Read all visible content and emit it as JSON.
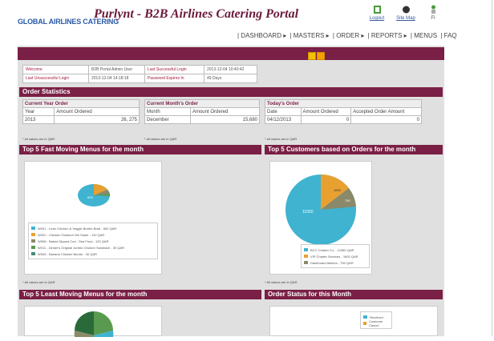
{
  "header": {
    "logo_text": "GLOBAL AIRLINES CATERING",
    "title": "Purlynt - B2B Airlines Catering Portal",
    "icons": [
      {
        "name": "logout-icon",
        "label": "Logout"
      },
      {
        "name": "site-map-icon",
        "label": "Site Map"
      },
      {
        "name": "faq-icon",
        "label": "FI"
      }
    ],
    "nav": [
      "| DASHBOARD ▸",
      "| MASTERS ▸",
      "| ORDER ▸",
      "| REPORTS ▸",
      "| MENUS",
      "| FAQ"
    ]
  },
  "info": {
    "welcome_label": "Welcome",
    "welcome_value": "B2B Portal Admin User",
    "last_success_label": "Last Successful Login",
    "last_success_value": "2013-12-04 10:40:42",
    "last_fail_label": "Last Unsuccessful Login",
    "last_fail_value": "2013-12-04 14:18:18",
    "pwd_expiry_label": "Password Expires In",
    "pwd_expiry_value": "49 Days"
  },
  "order_stats": {
    "title": "Order Statistics",
    "year": {
      "title": "Current Year Order",
      "h1": "Year",
      "h2": "Amount Ordered",
      "c1": "2013",
      "c2": "26, 275"
    },
    "month": {
      "title": "Current Month's Order",
      "h1": "Month",
      "h2": "Amount Ordered",
      "c1": "December",
      "c2": "15,680"
    },
    "today": {
      "title": "Today's Order",
      "h1": "Date",
      "h2": "Amount Ordered",
      "h3": "Accepted Order Amount",
      "c1": "04/12/2013",
      "c2": "0",
      "c3": "0"
    },
    "note": "* all values are in QAR"
  },
  "fast_menus": {
    "title": "Top 5 Fast Moving Menus for the month",
    "note": "* All values are in QAR",
    "legend": [
      "W001 - Lean Chicken & Veggie Burrito Bowl - 600 QAR",
      "W002 - Chicken Tandoori Stir Saute - 110 QAR",
      "W008 - Baked Dipped Cod - Sea Food - 120 QAR",
      "W011 - Dinner's Original Jumbo Chicken Sandwich - 30 QAR",
      "W005 - Banana Chicken Burrito - 30 QAR"
    ],
    "slice_label": "600"
  },
  "customers": {
    "title": "Top 5 Customers based on Orders for the month",
    "note": "* All values are in QAR",
    "legend": [
      "BCC Charter Co. - 11550 QAR",
      "VIP Charter Services - 1600 QAR",
      "Dashboard Airlines - 750 QAR"
    ],
    "slice_labels": [
      "11550",
      "1600",
      "750"
    ]
  },
  "least_menus": {
    "title": "Top 5 Least Moving Menus for the month"
  },
  "order_status": {
    "title": "Order Status for this Month",
    "legend": [
      "Received",
      "Customer Cancel"
    ]
  },
  "colors": {
    "maroon": "#7a1f45",
    "blue": "#3fb3d0",
    "orange": "#e8a030",
    "green": "#5a9a50",
    "teal": "#4a8a7a",
    "gray": "#8a8a6a"
  }
}
